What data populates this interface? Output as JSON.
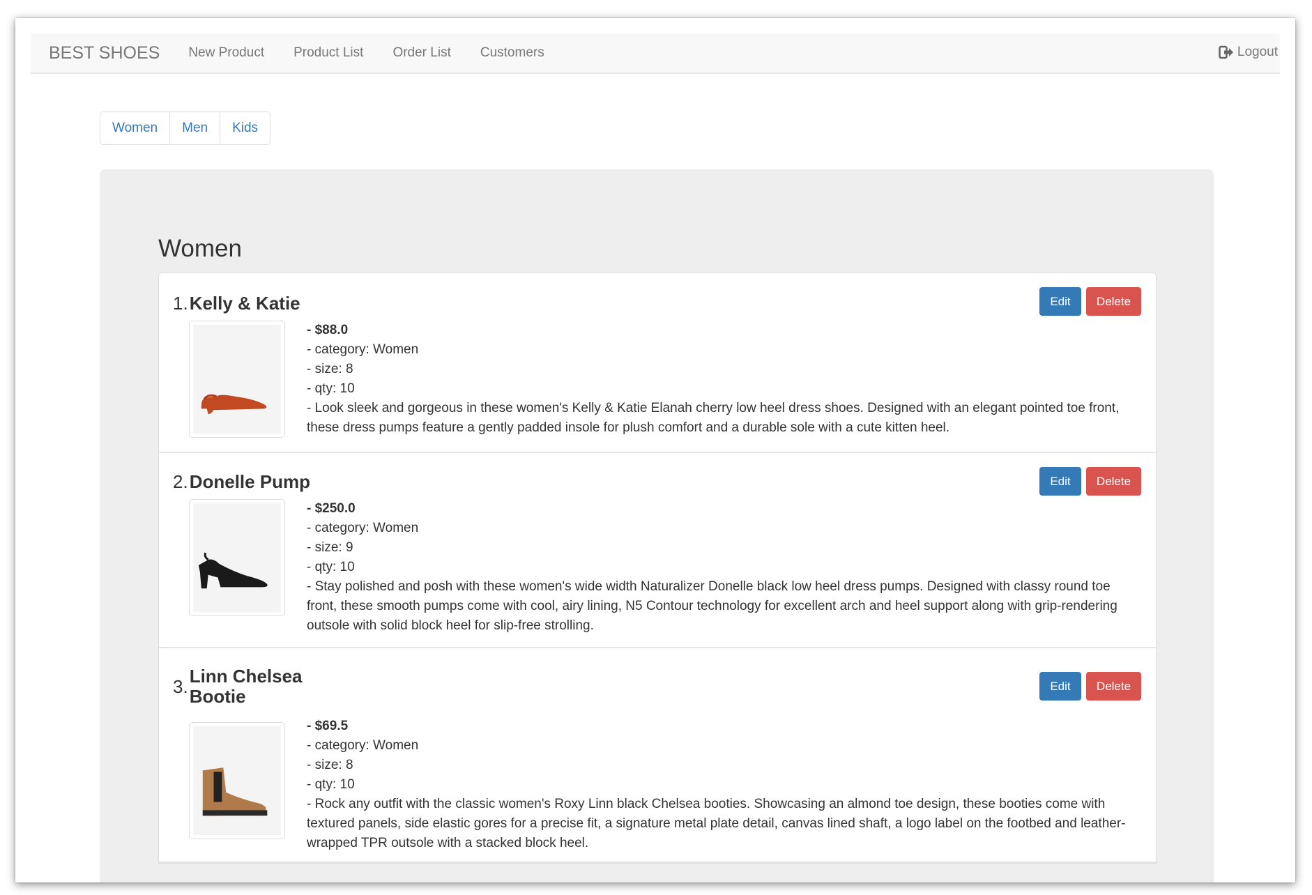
{
  "nav": {
    "brand": "BEST SHOES",
    "links": [
      "New Product",
      "Product List",
      "Order List",
      "Customers"
    ],
    "logout": "Logout"
  },
  "categories": [
    "Women",
    "Men",
    "Kids"
  ],
  "section_title": "Women",
  "actions": {
    "edit": "Edit",
    "delete": "Delete"
  },
  "products": [
    {
      "number": "1.",
      "name": "Kelly & Katie",
      "price": "- $88.0",
      "category": "- category: Women",
      "size": "- size: 8",
      "qty": "- qty: 10",
      "description": "- Look sleek and gorgeous in these women's Kelly & Katie Elanah cherry low heel dress shoes. Designed with an elegant pointed toe front, these dress pumps feature a gently padded insole for plush comfort and a durable sole with a cute kitten heel.",
      "image_icon": "red-slingback-shoe"
    },
    {
      "number": "2.",
      "name": "Donelle Pump",
      "price": "- $250.0",
      "category": "- category: Women",
      "size": "- size: 9",
      "qty": "- qty: 10",
      "description": "- Stay polished and posh with these women's wide width Naturalizer Donelle black low heel dress pumps. Designed with classy round toe front, these smooth pumps come with cool, airy lining, N5 Contour technology for excellent arch and heel support along with grip-rendering outsole with solid block heel for slip-free strolling.",
      "image_icon": "black-pump-shoe"
    },
    {
      "number": "3.",
      "name": "Linn Chelsea Bootie",
      "price": "- $69.5",
      "category": "- category: Women",
      "size": "- size: 8",
      "qty": "- qty: 10",
      "description": "- Rock any outfit with the classic women's Roxy Linn black Chelsea booties. Showcasing an almond toe design, these booties come with textured panels, side elastic gores for a precise fit, a signature metal plate detail, canvas lined shaft, a logo label on the footbed and leather-wrapped TPR outsole with a stacked block heel.",
      "image_icon": "tan-chelsea-boot"
    }
  ],
  "colors": {
    "edit": "#337ab7",
    "delete": "#d9534f",
    "link": "#337ab7",
    "panel": "#eeeeee"
  }
}
